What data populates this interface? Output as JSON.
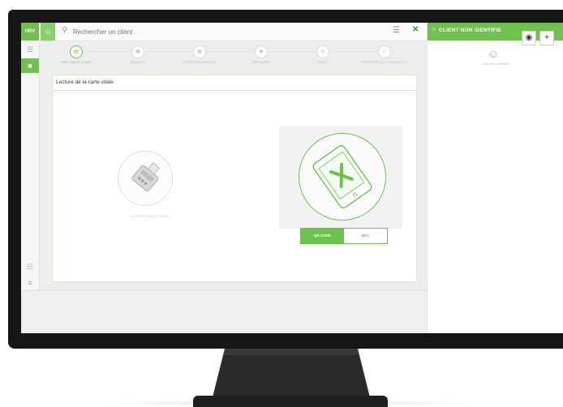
{
  "app": {
    "logo": "HRV"
  },
  "search": {
    "placeholder": "Rechercher un client"
  },
  "sidebar": {
    "items": [
      "☰",
      "■",
      "☷",
      "≡"
    ]
  },
  "stepper": {
    "steps": [
      {
        "label": "LIRE CARTE VITALE",
        "state": "active"
      },
      {
        "label": "SCANNER",
        "state": "inactive"
      },
      {
        "label": "SAISIR ORDONNANCE",
        "state": "inactive"
      },
      {
        "label": "DISPENSER",
        "state": "inactive"
      },
      {
        "label": "VENTE",
        "state": "inactive"
      },
      {
        "label": "CERTIFIER LA DISPENSATION",
        "state": "inactive"
      }
    ]
  },
  "card": {
    "title": "Lecture de la carte vitale"
  },
  "reader": {
    "caption": "LECTEUR CARTE VITALE"
  },
  "toggle": {
    "options": [
      "QR CODE",
      "NFC"
    ],
    "selected": "QR CODE"
  },
  "right_panel": {
    "title": "CLIENT NON IDENTIFIE",
    "hint": "Client non identifié"
  },
  "colors": {
    "accent": "#6cc24a",
    "bezel": "#161616"
  }
}
